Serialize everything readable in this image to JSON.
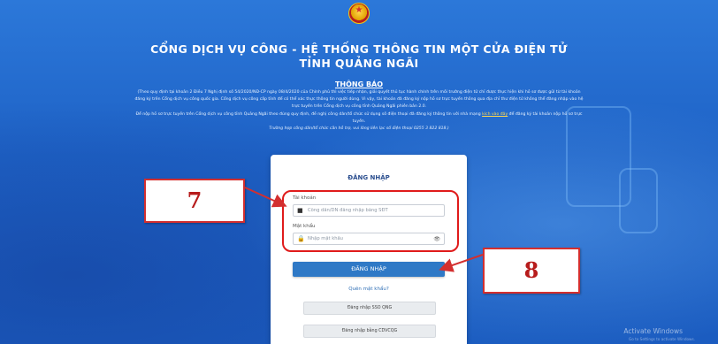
{
  "header": {
    "title_line1": "CỔNG DỊCH VỤ CÔNG - HỆ THỐNG THÔNG TIN MỘT CỬA ĐIỆN TỬ",
    "title_line2": "TỈNH QUẢNG NGÃI",
    "notice_title": "THÔNG BÁO",
    "notice_lines": [
      "(Theo quy định tại khoản 2 Điều 7 Nghị định số 54/2020/NĐ-CP ngày 08/4/2020 của Chính phủ thì việc tiếp nhận, giải quyết thủ tục hành chính trên môi trường điện tử chỉ được thực hiện khi hồ sơ được gửi từ tài khoản",
      "đăng ký trên Cổng dịch vụ công quốc gia. Cổng dịch vụ công cấp tỉnh để có thể xác thực thông tin người dùng. Vì vậy, tài khoản đã đăng ký nộp hồ sơ trực tuyến thông qua địa chỉ thư điện tử không thể đăng nhập vào hệ",
      "trực tuyến trên Cổng dịch vụ công tỉnh Quảng Ngãi phiên bản 2.0.",
      "Để nộp hồ sơ trực tuyến trên Cổng dịch vụ công tỉnh Quảng Ngãi theo đúng quy định, đề nghị công dân/tổ chức sử dụng số điện thoại đã đăng ký thông tin với nhà mạng",
      "tuyến.",
      "Trường hợp công dân/tổ chức cần hỗ trợ, vui lòng liên lạc số điện thoại 0255 3 822 818.)"
    ],
    "notice_link": "kích vào đây",
    "notice_line4_tail": " để đăng ký tài khoản nộp hồ sơ trực"
  },
  "login": {
    "title": "ĐĂNG NHẬP",
    "username_label": "Tài khoản",
    "username_placeholder": "Công dân/DN đăng nhập bằng SĐT",
    "password_label": "Mật khẩu",
    "password_placeholder": "Nhập mật khẩu",
    "submit_label": "ĐĂNG NHẬP",
    "forgot_label": "Quên mật khẩu?",
    "sso_label": "Đăng nhập SSO QNG",
    "vneid_label": "Đăng nhập bằng CDVCQG"
  },
  "annotations": {
    "step7": "7",
    "step8": "8"
  },
  "watermark": {
    "title": "Activate Windows",
    "subtitle": "Go to Settings to activate Windows."
  },
  "colors": {
    "background": "#1e63c8",
    "primary_button": "#2f79c6",
    "annotation_red": "#d32f2f",
    "link_yellow": "#ffd84d"
  }
}
